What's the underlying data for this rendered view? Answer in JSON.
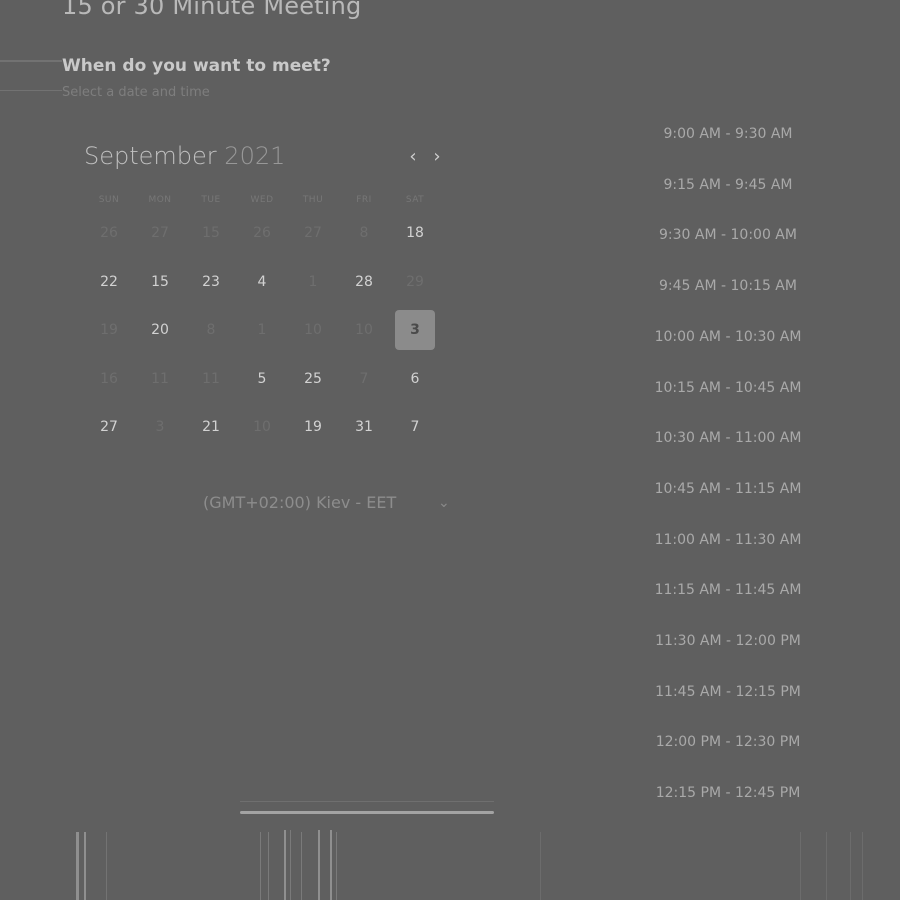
{
  "header": {
    "title": "15 or 30 Minute Meeting",
    "question": "When do you want to meet?",
    "subtitle": "Select a date and time"
  },
  "calendar": {
    "month": "September",
    "year": "2021",
    "prev_icon": "chevron-left-icon",
    "next_icon": "chevron-right-icon",
    "days_of_week": [
      "SUN",
      "MON",
      "TUE",
      "WED",
      "THU",
      "FRI",
      "SAT"
    ],
    "weeks": [
      [
        {
          "label": "26",
          "dim": true
        },
        {
          "label": "27",
          "dim": true
        },
        {
          "label": "15",
          "dim": true
        },
        {
          "label": "26",
          "dim": true
        },
        {
          "label": "27",
          "dim": true
        },
        {
          "label": "8",
          "dim": true
        },
        {
          "label": "18",
          "dim": false
        }
      ],
      [
        {
          "label": "22",
          "dim": false
        },
        {
          "label": "15",
          "dim": false
        },
        {
          "label": "23",
          "dim": false
        },
        {
          "label": "4",
          "dim": false
        },
        {
          "label": "1",
          "dim": true
        },
        {
          "label": "28",
          "dim": false
        },
        {
          "label": "29",
          "dim": true
        }
      ],
      [
        {
          "label": "19",
          "dim": true
        },
        {
          "label": "20",
          "dim": false
        },
        {
          "label": "8",
          "dim": true
        },
        {
          "label": "1",
          "dim": true
        },
        {
          "label": "10",
          "dim": true
        },
        {
          "label": "10",
          "dim": true
        },
        {
          "label": "3",
          "dim": false,
          "selected": true
        }
      ],
      [
        {
          "label": "16",
          "dim": true
        },
        {
          "label": "11",
          "dim": true
        },
        {
          "label": "11",
          "dim": true
        },
        {
          "label": "5",
          "dim": false
        },
        {
          "label": "25",
          "dim": false
        },
        {
          "label": "7",
          "dim": true
        },
        {
          "label": "6",
          "dim": false
        }
      ],
      [
        {
          "label": "27",
          "dim": false
        },
        {
          "label": "3",
          "dim": true
        },
        {
          "label": "21",
          "dim": false
        },
        {
          "label": "10",
          "dim": true
        },
        {
          "label": "19",
          "dim": false
        },
        {
          "label": "31",
          "dim": false
        },
        {
          "label": "7",
          "dim": false
        }
      ]
    ]
  },
  "timezone": {
    "label": "(GMT+02:00) Kiev - EET",
    "icon": "chevron-down-icon"
  },
  "time_slots": [
    "9:00 AM - 9:30 AM",
    "9:15 AM - 9:45 AM",
    "9:30 AM - 10:00 AM",
    "9:45 AM - 10:15 AM",
    "10:00 AM - 10:30 AM",
    "10:15 AM - 10:45 AM",
    "10:30 AM - 11:00 AM",
    "10:45 AM - 11:15 AM",
    "11:00 AM - 11:30 AM",
    "11:15 AM - 11:45 AM",
    "11:30 AM - 12:00 PM",
    "11:45 AM - 12:15 PM",
    "12:00 PM - 12:30 PM",
    "12:15 PM - 12:45 PM"
  ]
}
